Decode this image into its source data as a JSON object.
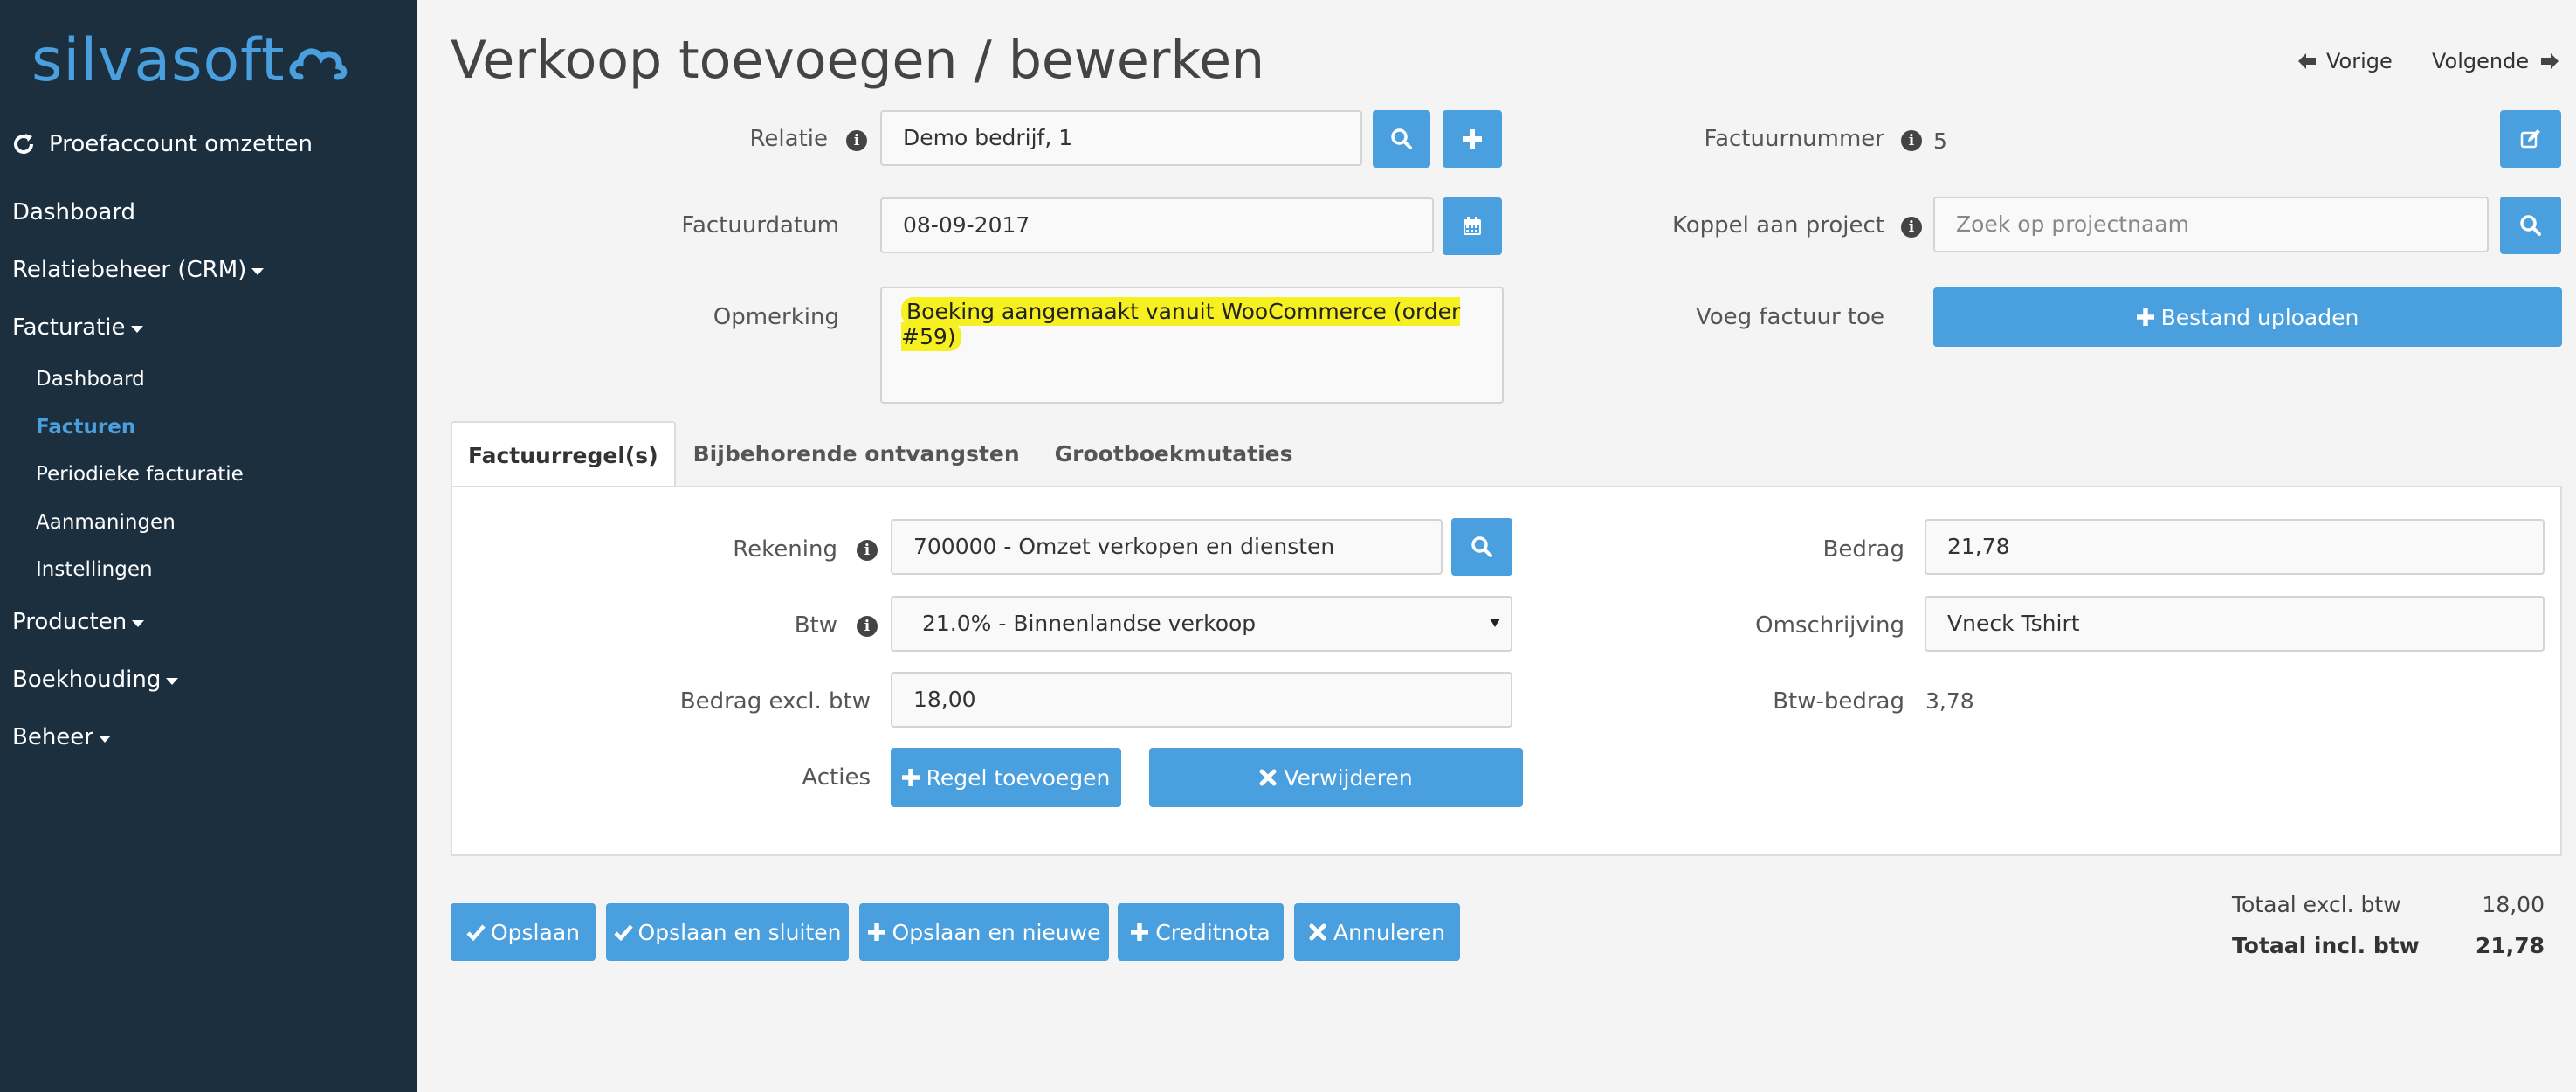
{
  "sidebar": {
    "logo": "silvasoft",
    "trial_label": "Proefaccount omzetten",
    "items": [
      {
        "label": "Dashboard"
      },
      {
        "label": "Relatiebeheer (CRM)"
      },
      {
        "label": "Facturatie"
      },
      {
        "label": "Producten"
      },
      {
        "label": "Boekhouding"
      },
      {
        "label": "Beheer"
      }
    ],
    "facturatie_sub": [
      {
        "label": "Dashboard"
      },
      {
        "label": "Facturen"
      },
      {
        "label": "Periodieke facturatie"
      },
      {
        "label": "Aanmaningen"
      },
      {
        "label": "Instellingen"
      }
    ]
  },
  "page": {
    "title": "Verkoop toevoegen / bewerken",
    "prev_label": "Vorige",
    "next_label": "Volgende"
  },
  "form": {
    "relatie_label": "Relatie",
    "relatie_value": "Demo bedrijf, 1",
    "factuurdatum_label": "Factuurdatum",
    "factuurdatum_value": "08-09-2017",
    "opmerking_label": "Opmerking",
    "opmerking_value": "Boeking aangemaakt vanuit WooCommerce (order #59)",
    "factuurnummer_label": "Factuurnummer",
    "factuurnummer_value": "5",
    "project_label": "Koppel aan project",
    "project_placeholder": "Zoek op projectnaam",
    "upload_label": "Voeg factuur toe",
    "upload_button": "Bestand uploaden"
  },
  "tabs": [
    {
      "label": "Factuurregel(s)"
    },
    {
      "label": "Bijbehorende ontvangsten"
    },
    {
      "label": "Grootboekmutaties"
    }
  ],
  "line": {
    "rekening_label": "Rekening",
    "rekening_value": "700000 - Omzet verkopen en diensten",
    "btw_label": "Btw",
    "btw_value": "21.0% - Binnenlandse verkoop",
    "excl_label": "Bedrag excl. btw",
    "excl_value": "18,00",
    "acties_label": "Acties",
    "add_button": "Regel toevoegen",
    "delete_button": "Verwijderen",
    "bedrag_label": "Bedrag",
    "bedrag_value": "21,78",
    "omschrijving_label": "Omschrijving",
    "omschrijving_value": "Vneck Tshirt",
    "btw_bedrag_label": "Btw-bedrag",
    "btw_bedrag_value": "3,78"
  },
  "actions": {
    "save": "Opslaan",
    "save_close": "Opslaan en sluiten",
    "save_new": "Opslaan en nieuwe",
    "credit": "Creditnota",
    "cancel": "Annuleren"
  },
  "totals": {
    "excl_label": "Totaal excl. btw",
    "excl_value": "18,00",
    "incl_label": "Totaal incl. btw",
    "incl_value": "21,78"
  },
  "colors": {
    "sidebar_bg": "#1c2f3f",
    "accent": "#4a9fde",
    "highlight": "#f6f020"
  },
  "icons": [
    "refresh-icon",
    "cloud-icon",
    "arrow-left-icon",
    "arrow-right-icon",
    "info-icon",
    "search-icon",
    "plus-icon",
    "calendar-icon",
    "edit-icon",
    "check-icon",
    "times-icon"
  ]
}
